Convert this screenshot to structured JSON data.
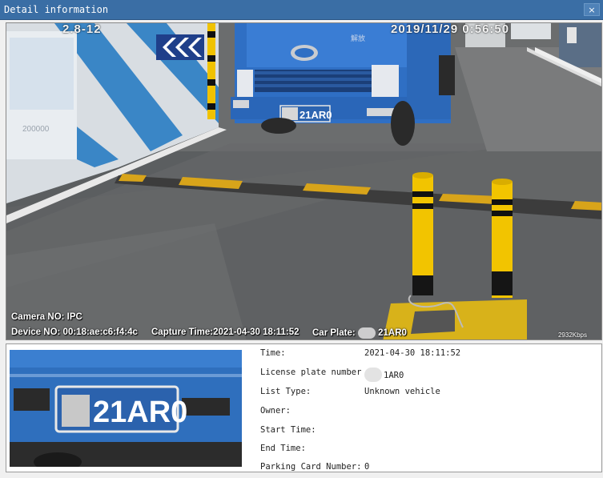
{
  "window": {
    "title": "Detail information",
    "close_glyph": "×"
  },
  "photo": {
    "camera_no": "Camera NO: IPC",
    "device_no": "Device NO: 00:18:ae:c6:f4:4c",
    "capture_time": "Capture Time:2021-04-30 18:11:52",
    "car_plate_label": "Car Plate:",
    "car_plate_value": "21AR0",
    "bitrate": "2932Kbps",
    "top_left_text": "2.8-12",
    "top_right_text": "2019/11/29  0:56:50",
    "wall_sign_text": "200000",
    "truck_badge": "解放",
    "truck_plate": "21AR0"
  },
  "plate_crop": {
    "plate_text": "21AR0"
  },
  "info": {
    "rows": [
      {
        "label": "Time:",
        "value": "2021-04-30 18:11:52"
      },
      {
        "label": "License plate number",
        "value": "1AR0"
      },
      {
        "label": "List Type:",
        "value": "Unknown vehicle"
      },
      {
        "label": "Owner:",
        "value": ""
      },
      {
        "label": "Start Time:",
        "value": ""
      },
      {
        "label": "End Time:",
        "value": ""
      },
      {
        "label": "Parking Card Number:",
        "value": "0"
      }
    ]
  },
  "colors": {
    "titlebar": "#3a6ea5",
    "truck_blue": "#2f6fc4",
    "bollard_yellow": "#f2c400"
  }
}
